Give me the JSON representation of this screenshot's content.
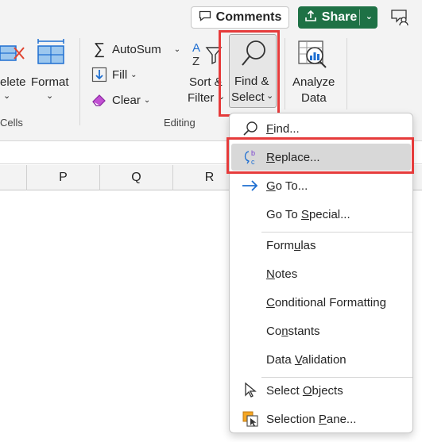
{
  "topbar": {
    "comments_label": "Comments",
    "share_label": "Share"
  },
  "ribbon": {
    "cells": {
      "delete_label": "elete",
      "format_label": "Format",
      "group_label": "Cells"
    },
    "editing": {
      "autosum_label": "AutoSum",
      "fill_label": "Fill",
      "clear_label": "Clear",
      "sort_filter_line1": "Sort &",
      "sort_filter_line2": "Filter",
      "find_select_line1": "Find &",
      "find_select_line2": "Select",
      "group_label": "Editing"
    },
    "analysis": {
      "analyze_line1": "Analyze",
      "analyze_line2": "Data"
    }
  },
  "columns": [
    "P",
    "Q",
    "R"
  ],
  "menu": {
    "items": [
      {
        "key": "find",
        "label": "Find...",
        "icon": "magnifier-icon",
        "underline": "F"
      },
      {
        "key": "replace",
        "label": "Replace...",
        "icon": "replace-icon",
        "underline": "R",
        "highlighted": true
      },
      {
        "key": "goto",
        "label": "Go To...",
        "icon": "arrow-right-icon",
        "underline": "G"
      },
      {
        "key": "goto_special",
        "label": "Go To Special...",
        "icon": "",
        "underline": "S"
      },
      {
        "key": "formulas",
        "label": "Formulas",
        "icon": "",
        "underline": "u"
      },
      {
        "key": "notes",
        "label": "Notes",
        "icon": "",
        "underline": "N"
      },
      {
        "key": "conditional_formatting",
        "label": "Conditional Formatting",
        "icon": "",
        "underline": "C"
      },
      {
        "key": "constants",
        "label": "Constants",
        "icon": "",
        "underline": "n"
      },
      {
        "key": "data_validation",
        "label": "Data Validation",
        "icon": "",
        "underline": "V"
      },
      {
        "key": "select_objects",
        "label": "Select Objects",
        "icon": "cursor-icon",
        "underline": "O"
      },
      {
        "key": "selection_pane",
        "label": "Selection Pane...",
        "icon": "selection-pane-icon",
        "underline": "P"
      }
    ]
  },
  "colors": {
    "share_green": "#1e7145",
    "highlight_red": "#e63b3b",
    "accent_blue": "#1f6fd1"
  }
}
